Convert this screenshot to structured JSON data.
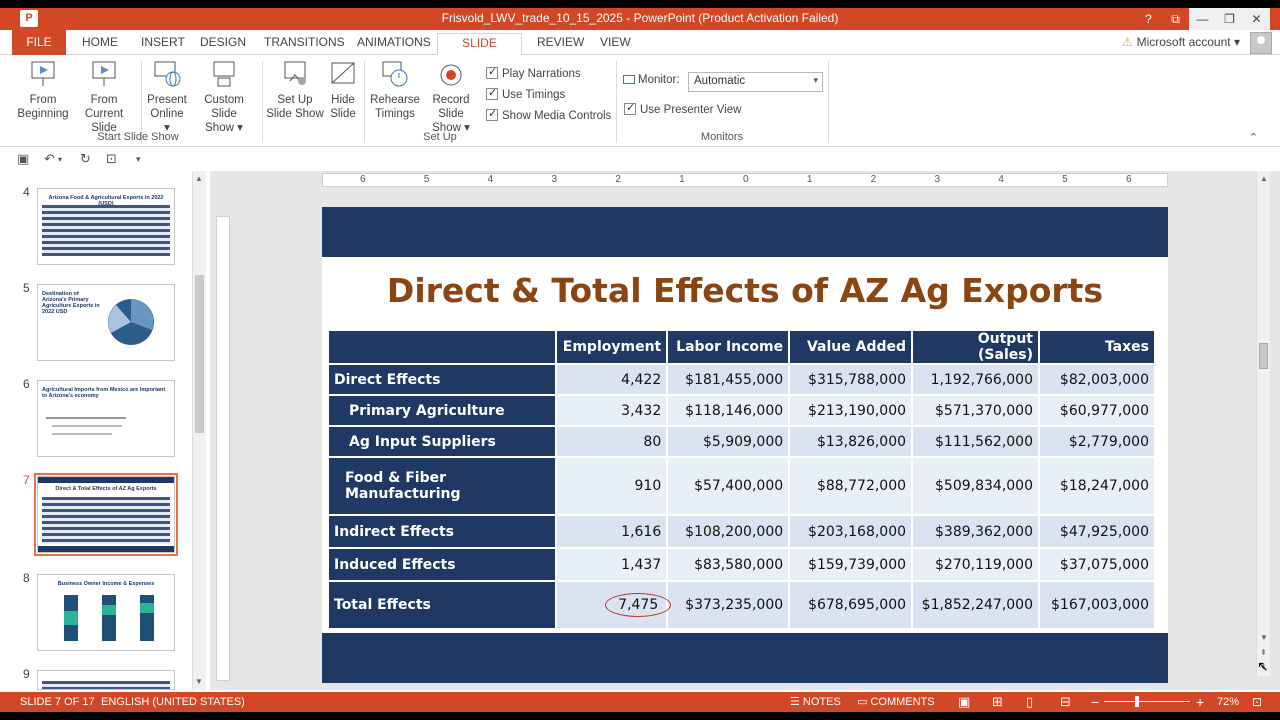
{
  "window": {
    "title": "Frisvold_LWV_trade_10_15_2025 - PowerPoint (Product Activation Failed)",
    "app_logo": "P",
    "buttons": [
      "?",
      "⧉",
      "—",
      "❐",
      "✕"
    ]
  },
  "tabs": {
    "file": "FILE",
    "items": [
      "HOME",
      "INSERT",
      "DESIGN",
      "TRANSITIONS",
      "ANIMATIONS",
      "SLIDE SHOW",
      "REVIEW",
      "VIEW"
    ],
    "active": "SLIDE SHOW"
  },
  "account": {
    "label": "Microsoft account",
    "caret": "▾"
  },
  "ribbon": {
    "start": {
      "from_beginning": [
        "From",
        "Beginning"
      ],
      "from_current": [
        "From",
        "Current Slide"
      ],
      "present_online": [
        "Present",
        "Online ▾"
      ],
      "custom_show": [
        "Custom Slide",
        "Show ▾"
      ],
      "label": "Start Slide Show"
    },
    "setup": {
      "set_up": [
        "Set Up",
        "Slide Show"
      ],
      "hide": [
        "Hide",
        "Slide"
      ],
      "rehearse": [
        "Rehearse",
        "Timings"
      ],
      "record": [
        "Record Slide",
        "Show ▾"
      ],
      "play_narrations": "Play Narrations",
      "use_timings": "Use Timings",
      "show_media": "Show Media Controls",
      "label": "Set Up"
    },
    "monitors": {
      "monitor_label": "Monitor:",
      "monitor_value": "Automatic",
      "presenter_view": "Use Presenter View",
      "label": "Monitors"
    }
  },
  "thumbnails": [
    {
      "num": "4",
      "title": "Arizona Food & Agricultural Exports in 2022 (USD)"
    },
    {
      "num": "5",
      "title": "Destination of Arizona's Primary Agriculture Exports in 2022 USD"
    },
    {
      "num": "6",
      "title": "Agricultural Imports from Mexico are Important to Arizona's economy"
    },
    {
      "num": "7",
      "title": "Direct & Total Effects of AZ Ag Exports"
    },
    {
      "num": "8",
      "title": "Business Owner Income & Expenses"
    },
    {
      "num": "9",
      "title": ""
    }
  ],
  "ruler": {
    "ticks": [
      "6",
      "5",
      "4",
      "3",
      "2",
      "1",
      "0",
      "1",
      "2",
      "3",
      "4",
      "5",
      "6"
    ]
  },
  "slide": {
    "title": "Direct & Total Effects of AZ Ag Exports",
    "table": {
      "headers": [
        "",
        "Employment",
        "Labor Income",
        "Value Added",
        "Output (Sales)",
        "Taxes"
      ],
      "rows": [
        {
          "label": "Direct Effects",
          "values": [
            "4,422",
            "$181,455,000",
            "$315,788,000",
            "1,192,766,000",
            "$82,003,000"
          ]
        },
        {
          "label": "Primary Agriculture",
          "values": [
            "3,432",
            "$118,146,000",
            "$213,190,000",
            "$571,370,000",
            "$60,977,000"
          ]
        },
        {
          "label": "Ag Input Suppliers",
          "values": [
            "80",
            "$5,909,000",
            "$13,826,000",
            "$111,562,000",
            "$2,779,000"
          ]
        },
        {
          "label": "Food & Fiber Manufacturing",
          "values": [
            "910",
            "$57,400,000",
            "$88,772,000",
            "$509,834,000",
            "$18,247,000"
          ]
        },
        {
          "label": "Indirect Effects",
          "values": [
            "1,616",
            "$108,200,000",
            "$203,168,000",
            "$389,362,000",
            "$47,925,000"
          ]
        },
        {
          "label": "Induced Effects",
          "values": [
            "1,437",
            "$83,580,000",
            "$159,739,000",
            "$270,119,000",
            "$37,075,000"
          ]
        },
        {
          "label": "Total Effects",
          "values": [
            "7,475",
            "$373,235,000",
            "$678,695,000",
            "$1,852,247,000",
            "$167,003,000"
          ]
        }
      ]
    }
  },
  "statusbar": {
    "slide_info": "SLIDE 7 OF 17",
    "language": "ENGLISH (UNITED STATES)",
    "notes": "NOTES",
    "comments": "COMMENTS",
    "zoom": "72%",
    "zoom_level_percent": 72
  },
  "colors": {
    "accent": "#d24726",
    "slide_navy": "#1f3864",
    "title_brown": "#8b4513"
  }
}
